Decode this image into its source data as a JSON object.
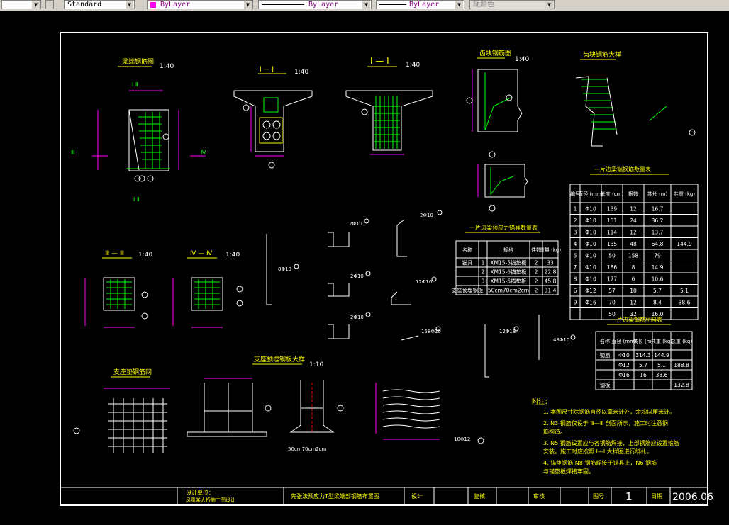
{
  "toolbar": {
    "textstyle": "Standard",
    "layer_color": "ByLayer",
    "linetype": "ByLayer",
    "lineweight": "ByLayer",
    "plotstyle": "随颜色",
    "arrow": "▼"
  },
  "drawing": {
    "view_titles": {
      "a": "梁端钢筋图",
      "b": "J — J",
      "c": "I — I",
      "d": "齿块钢筋图",
      "e": "齿块钢筋大样",
      "f": "Ⅲ — Ⅲ",
      "g": "Ⅳ — Ⅳ",
      "h": "支座垫钢筋网",
      "i": "支座预埋钢板大样"
    },
    "scales": {
      "s40": "1:40",
      "s10": "1:10"
    },
    "table1_title": "一片边梁端钢筋数量表",
    "table1": {
      "headers": [
        "编号",
        "直径\n(mm)",
        "长度\n(cm)",
        "根数",
        "共长\n(m)",
        "共重\n(kg)"
      ],
      "rows": [
        [
          "1",
          "Φ10",
          "139",
          "12",
          "16.7",
          ""
        ],
        [
          "2",
          "Φ10",
          "151",
          "24",
          "36.2",
          ""
        ],
        [
          "3",
          "Φ10",
          "114",
          "12",
          "13.7",
          ""
        ],
        [
          "4",
          "Φ10",
          "135",
          "48",
          "64.8",
          "144.9"
        ],
        [
          "5",
          "Φ10",
          "50",
          "158",
          "79",
          ""
        ],
        [
          "7",
          "Φ10",
          "186",
          "8",
          "14.9",
          ""
        ],
        [
          "8",
          "Φ10",
          "177",
          "6",
          "10.6",
          ""
        ],
        [
          "6",
          "Φ12",
          "57",
          "10",
          "5.7",
          "5.1"
        ],
        [
          "9",
          "Φ16",
          "70",
          "12",
          "8.4",
          "38.6"
        ],
        [
          "",
          "",
          "50",
          "32",
          "16.0",
          ""
        ]
      ]
    },
    "table2_title": "一片边梁预应力锚具数量表",
    "table2": {
      "headers": [
        "名称",
        "",
        "规格",
        "件数",
        "重量\n(kg)"
      ],
      "rows": [
        [
          "锚具",
          "1",
          "XM15-5锚垫板",
          "2",
          "33"
        ],
        [
          "",
          "2",
          "XM15-6锚垫板",
          "2",
          "22.8"
        ],
        [
          "",
          "3",
          "XM15-6锚垫板",
          "2",
          "45.8"
        ],
        [
          "支座预埋钢板",
          "",
          "50cm70cm2cm",
          "2",
          "31.4"
        ]
      ]
    },
    "table3_title": "一片边梁钢筋材料表",
    "table3": {
      "headers": [
        "名称",
        "直径\n(mm)",
        "共长\n(m)",
        "共重\n(kg)",
        "总重\n(kg)"
      ],
      "rows": [
        [
          "钢筋",
          "Φ10",
          "314.3",
          "144.9",
          ""
        ],
        [
          "",
          "Φ12",
          "5.7",
          "5.1",
          "188.8"
        ],
        [
          "",
          "Φ16",
          "16",
          "38.6",
          ""
        ],
        [
          "钢板",
          "",
          "",
          "",
          "132.8"
        ]
      ]
    },
    "notes_title": "附注：",
    "notes": [
      "1. 本图尺寸除钢筋直径以毫米计外，余均以厘米计。",
      "2. N3  钢筋仅设于 Ⅲ—Ⅲ  剖面所示，施工时注意钢",
      "   筋构造。",
      "3. N5  钢筋设置应与各钢筋焊接，上部钢筋应设置箍筋",
      "   安装。施工时应按照  I—I  大样图进行绑扎。",
      "4.  锚垫钢筋  N8  钢筋焊接于锚具上，N6  钢筋",
      "    与锚垫板焊接牢固。"
    ],
    "title_block": {
      "designer": "设计单位：",
      "project": "凤凰某大桥施工图设计",
      "drawing_title": "先张法预应力T型梁端部钢筋布置图",
      "design": "设计",
      "review": "复核",
      "approve": "审核",
      "sheet_label": "图号",
      "sheet_no": "1",
      "date_label": "日期",
      "date": "2006.06"
    },
    "rebar_labels": [
      {
        "id": "l1",
        "text": "2Φ10"
      },
      {
        "id": "l2",
        "text": "2Φ10"
      },
      {
        "id": "l3",
        "text": "2Φ10"
      },
      {
        "id": "l4",
        "text": "2Φ10"
      },
      {
        "id": "l5",
        "text": "12Φ10"
      },
      {
        "id": "l6",
        "text": "158Φ10"
      },
      {
        "id": "l7",
        "text": "8Φ10"
      },
      {
        "id": "l8",
        "text": "12Φ18"
      },
      {
        "id": "l9",
        "text": "48Φ10"
      },
      {
        "id": "l10",
        "text": "10Φ12"
      },
      {
        "id": "l11",
        "text": "50cm70cm2cm"
      }
    ]
  }
}
